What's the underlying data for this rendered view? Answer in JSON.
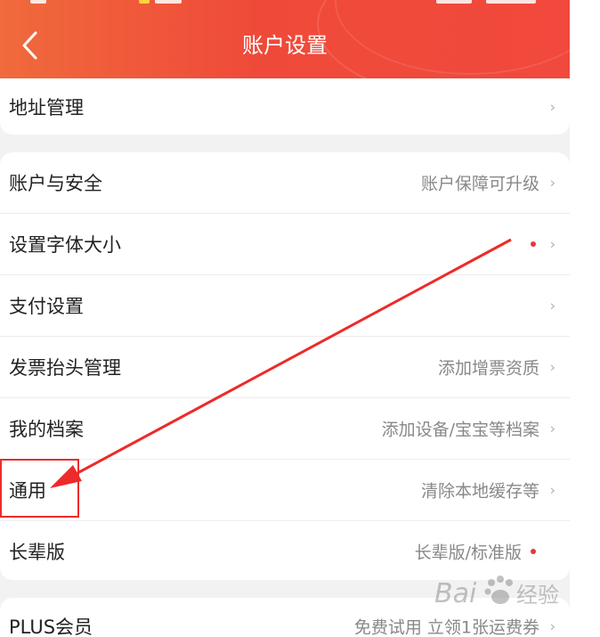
{
  "header": {
    "title": "账户设置",
    "back_icon": "chevron-left-icon",
    "background_color": "#ef4a39"
  },
  "groups": [
    {
      "items": [
        {
          "label": "地址管理",
          "value": "",
          "badge": false
        }
      ]
    },
    {
      "items": [
        {
          "label": "账户与安全",
          "value": "账户保障可升级",
          "badge": false
        },
        {
          "label": "设置字体大小",
          "value": "",
          "badge": true
        },
        {
          "label": "支付设置",
          "value": "",
          "badge": false
        },
        {
          "label": "发票抬头管理",
          "value": "添加增票资质",
          "badge": false
        },
        {
          "label": "我的档案",
          "value": "添加设备/宝宝等档案",
          "badge": false
        },
        {
          "label": "通用",
          "value": "清除本地缓存等",
          "badge": false
        },
        {
          "label": "长辈版",
          "value": "长辈版/标准版",
          "badge": true
        }
      ]
    },
    {
      "items": [
        {
          "label": "PLUS会员",
          "value": "免费试用 立领1张运费券",
          "badge": false
        }
      ]
    }
  ],
  "chevron_glyph": "›",
  "annotation": {
    "highlight_color": "#ee2a2a",
    "target_item": "通用"
  },
  "watermark": {
    "text": "Bai经验"
  }
}
